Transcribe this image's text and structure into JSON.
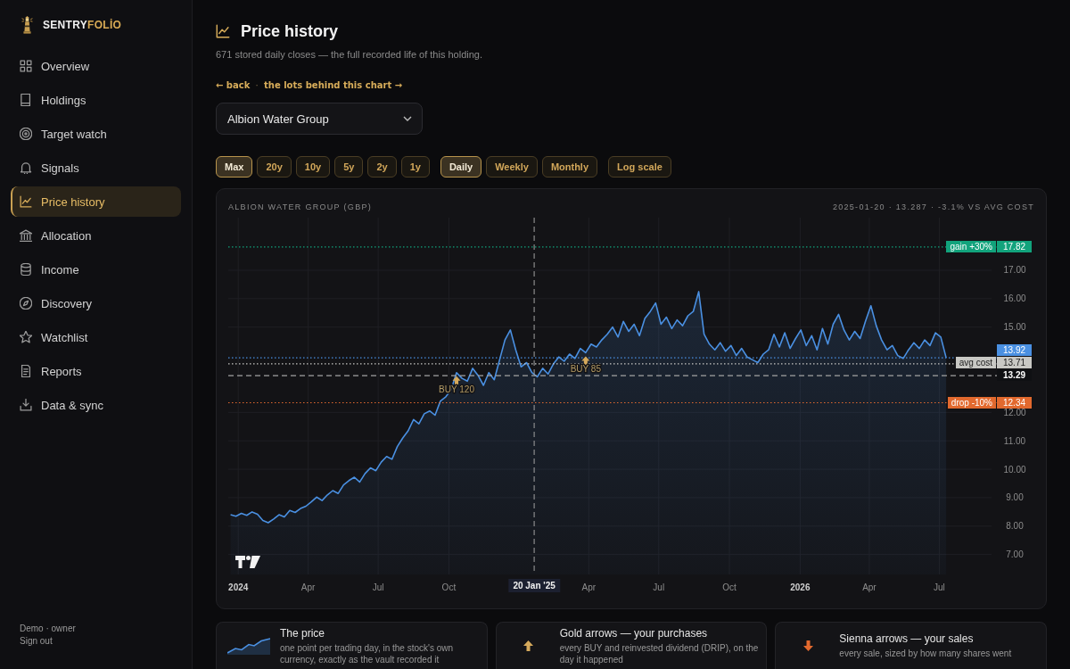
{
  "brand": {
    "name_start": "SENTRY",
    "name_end": "FOLİO"
  },
  "sidebar": {
    "items": [
      {
        "label": "Overview",
        "selected": false
      },
      {
        "label": "Holdings",
        "selected": false
      },
      {
        "label": "Target watch",
        "selected": false
      },
      {
        "label": "Signals",
        "selected": false
      },
      {
        "label": "Price history",
        "selected": true
      },
      {
        "label": "Allocation",
        "selected": false
      },
      {
        "label": "Income",
        "selected": false
      },
      {
        "label": "Discovery",
        "selected": false
      },
      {
        "label": "Watchlist",
        "selected": false
      },
      {
        "label": "Reports",
        "selected": false
      },
      {
        "label": "Data & sync",
        "selected": false
      }
    ],
    "footer": {
      "user": "Demo · owner",
      "sign_out": "Sign out"
    }
  },
  "page": {
    "title": "Price history",
    "subtitle": "671 stored daily closes — the full recorded life of this holding."
  },
  "links": {
    "back": "← back",
    "separator": "·",
    "lots": "the lots behind this chart →"
  },
  "holding_select": {
    "value": "Albion Water Group"
  },
  "range_options": [
    {
      "label": "Max",
      "selected": true
    },
    {
      "label": "20y",
      "selected": false
    },
    {
      "label": "10y",
      "selected": false
    },
    {
      "label": "5y",
      "selected": false
    },
    {
      "label": "2y",
      "selected": false
    },
    {
      "label": "1y",
      "selected": false
    }
  ],
  "interval_options": [
    {
      "label": "Daily",
      "selected": true
    },
    {
      "label": "Weekly",
      "selected": false
    },
    {
      "label": "Monthly",
      "selected": false
    }
  ],
  "log_scale": {
    "label": "Log scale",
    "on": false
  },
  "chart": {
    "readout": "2025-01-20 · 13.287 · -3.1% VS AVG COST",
    "chart_data": {
      "type": "area",
      "title": "ALBION WATER GROUP (GBP)",
      "x": [
        "2023-12-22",
        "2023-12-29",
        "2024-01-05",
        "2024-01-12",
        "2024-01-19",
        "2024-01-26",
        "2024-02-02",
        "2024-02-09",
        "2024-02-16",
        "2024-02-23",
        "2024-03-01",
        "2024-03-08",
        "2024-03-15",
        "2024-03-22",
        "2024-03-29",
        "2024-04-05",
        "2024-04-12",
        "2024-04-19",
        "2024-04-26",
        "2024-05-03",
        "2024-05-10",
        "2024-05-17",
        "2024-05-24",
        "2024-05-31",
        "2024-06-07",
        "2024-06-14",
        "2024-06-21",
        "2024-06-28",
        "2024-07-05",
        "2024-07-12",
        "2024-07-19",
        "2024-07-26",
        "2024-08-02",
        "2024-08-09",
        "2024-08-16",
        "2024-08-23",
        "2024-08-30",
        "2024-09-06",
        "2024-09-13",
        "2024-09-20",
        "2024-09-27",
        "2024-10-04",
        "2024-10-11",
        "2024-10-18",
        "2024-10-25",
        "2024-11-01",
        "2024-11-08",
        "2024-11-15",
        "2024-11-22",
        "2024-11-29",
        "2024-12-06",
        "2024-12-13",
        "2024-12-20",
        "2024-12-27",
        "2025-01-03",
        "2025-01-10",
        "2025-01-17",
        "2025-01-24",
        "2025-01-31",
        "2025-02-07",
        "2025-02-14",
        "2025-02-21",
        "2025-02-28",
        "2025-03-07",
        "2025-03-14",
        "2025-03-21",
        "2025-03-28",
        "2025-04-04",
        "2025-04-11",
        "2025-04-18",
        "2025-04-25",
        "2025-05-02",
        "2025-05-09",
        "2025-05-16",
        "2025-05-23",
        "2025-05-30",
        "2025-06-06",
        "2025-06-13",
        "2025-06-20",
        "2025-06-27",
        "2025-07-04",
        "2025-07-11",
        "2025-07-18",
        "2025-07-25",
        "2025-08-01",
        "2025-08-08",
        "2025-08-15",
        "2025-08-22",
        "2025-08-29",
        "2025-09-05",
        "2025-09-12",
        "2025-09-19",
        "2025-09-26",
        "2025-10-03",
        "2025-10-10",
        "2025-10-17",
        "2025-10-24",
        "2025-10-31",
        "2025-11-07",
        "2025-11-14",
        "2025-11-21",
        "2025-11-28",
        "2025-12-05",
        "2025-12-12",
        "2025-12-19",
        "2025-12-26",
        "2026-01-02",
        "2026-01-09",
        "2026-01-16",
        "2026-01-23",
        "2026-01-30",
        "2026-02-06",
        "2026-02-13",
        "2026-02-20",
        "2026-02-27",
        "2026-03-06",
        "2026-03-13",
        "2026-03-20",
        "2026-03-27",
        "2026-04-03",
        "2026-04-10",
        "2026-04-17",
        "2026-04-24",
        "2026-05-01",
        "2026-05-08",
        "2026-05-15",
        "2026-05-22",
        "2026-05-29",
        "2026-06-05",
        "2026-06-12",
        "2026-06-19",
        "2026-06-26",
        "2026-07-03",
        "2026-07-10"
      ],
      "series": [
        {
          "color": "#4a90e2",
          "values": [
            8.4,
            8.35,
            8.45,
            8.38,
            8.5,
            8.42,
            8.2,
            8.12,
            8.25,
            8.4,
            8.32,
            8.55,
            8.48,
            8.62,
            8.7,
            8.85,
            9.02,
            8.9,
            9.1,
            9.25,
            9.15,
            9.45,
            9.6,
            9.72,
            9.55,
            9.85,
            10.05,
            9.95,
            10.25,
            10.45,
            10.35,
            10.8,
            11.1,
            11.35,
            11.75,
            11.6,
            11.95,
            12.05,
            11.9,
            12.4,
            12.55,
            12.8,
            13.4,
            13.2,
            13.1,
            13.55,
            13.3,
            12.95,
            13.4,
            13.15,
            13.85,
            14.55,
            14.9,
            14.2,
            13.6,
            13.75,
            13.4,
            13.25,
            13.55,
            13.35,
            13.7,
            13.95,
            13.8,
            14.05,
            13.9,
            14.25,
            14.1,
            14.4,
            14.3,
            14.55,
            14.75,
            15.0,
            14.65,
            15.2,
            14.85,
            15.1,
            14.7,
            15.3,
            15.55,
            15.85,
            15.1,
            15.35,
            14.95,
            15.25,
            15.05,
            15.4,
            15.55,
            16.25,
            14.75,
            14.4,
            14.2,
            14.45,
            14.15,
            14.35,
            14.0,
            14.25,
            13.95,
            13.85,
            13.75,
            14.05,
            14.2,
            14.75,
            14.3,
            14.8,
            14.25,
            14.6,
            14.9,
            14.35,
            14.7,
            14.2,
            14.95,
            14.4,
            15.1,
            15.45,
            14.9,
            14.55,
            14.85,
            14.6,
            15.2,
            15.75,
            15.05,
            14.55,
            14.2,
            14.35,
            14.0,
            13.9,
            14.2,
            14.45,
            14.25,
            14.55,
            14.35,
            14.8,
            14.65,
            13.92
          ]
        }
      ],
      "xlim": [
        "2023-12-19",
        "2026-09-07"
      ],
      "ylim": [
        6.3,
        18.85
      ],
      "grid": true,
      "xticks": [
        {
          "value": "2024-01-01",
          "label": "2024"
        },
        {
          "value": "2024-04-01",
          "label": "Apr"
        },
        {
          "value": "2024-07-01",
          "label": "Jul"
        },
        {
          "value": "2024-10-01",
          "label": "Oct"
        },
        {
          "value": "2025-04-01",
          "label": "Apr"
        },
        {
          "value": "2025-07-01",
          "label": "Jul"
        },
        {
          "value": "2025-10-01",
          "label": "Oct"
        },
        {
          "value": "2026-01-01",
          "label": "2026"
        },
        {
          "value": "2026-04-01",
          "label": "Apr"
        },
        {
          "value": "2026-07-01",
          "label": "Jul"
        }
      ],
      "yticks": [
        {
          "value": 7,
          "label": "7.00"
        },
        {
          "value": 8,
          "label": "8.00"
        },
        {
          "value": 9,
          "label": "9.00"
        },
        {
          "value": 10,
          "label": "10.00"
        },
        {
          "value": 11,
          "label": "11.00"
        },
        {
          "value": 12,
          "label": "12.00"
        },
        {
          "value": 12.34,
          "label": "12.34"
        },
        {
          "value": 13.29,
          "label": "13.29"
        },
        {
          "value": 13.71,
          "label": "13.71"
        },
        {
          "value": 15,
          "label": "15.00"
        },
        {
          "value": 16,
          "label": "16.00"
        },
        {
          "value": 17,
          "label": "17.00"
        },
        {
          "value": 17.82,
          "label": "17.82"
        }
      ],
      "ref_lines": [
        {
          "axis": "y",
          "value": 17.82,
          "label": "gain +30%",
          "color": "#12a37c"
        },
        {
          "axis": "y",
          "value": 13.92,
          "color": "#4a90e2"
        },
        {
          "axis": "y",
          "value": 13.71,
          "label": "avg cost",
          "color": "#c8c8c4"
        },
        {
          "axis": "y",
          "value": 13.29,
          "color": "#a3a3a3"
        },
        {
          "axis": "x",
          "value": "2025-01-20",
          "label": "20 Jan '25",
          "color": "#a3a3a3"
        },
        {
          "axis": "y",
          "value": 12.34,
          "label": "drop -10%",
          "color": "#e2692e"
        }
      ],
      "annotations": [
        {
          "text": "BUY 120",
          "x": "2024-10-11",
          "y": 13.4
        },
        {
          "text": "BUY 85",
          "x": "2025-03-28",
          "y": 14.1
        },
        "13.92"
      ]
    }
  },
  "legend": [
    {
      "kind": "line",
      "title": "The price",
      "text": "one point per trading day, in the stock's own currency, exactly as the vault recorded it"
    },
    {
      "kind": "buy",
      "title": "Gold arrows — your purchases",
      "text": "every BUY and reinvested dividend (DRIP), on the day it happened"
    },
    {
      "kind": "sell",
      "title": "Sienna arrows — your sales",
      "text": "every sale, sized by how many shares went"
    }
  ]
}
